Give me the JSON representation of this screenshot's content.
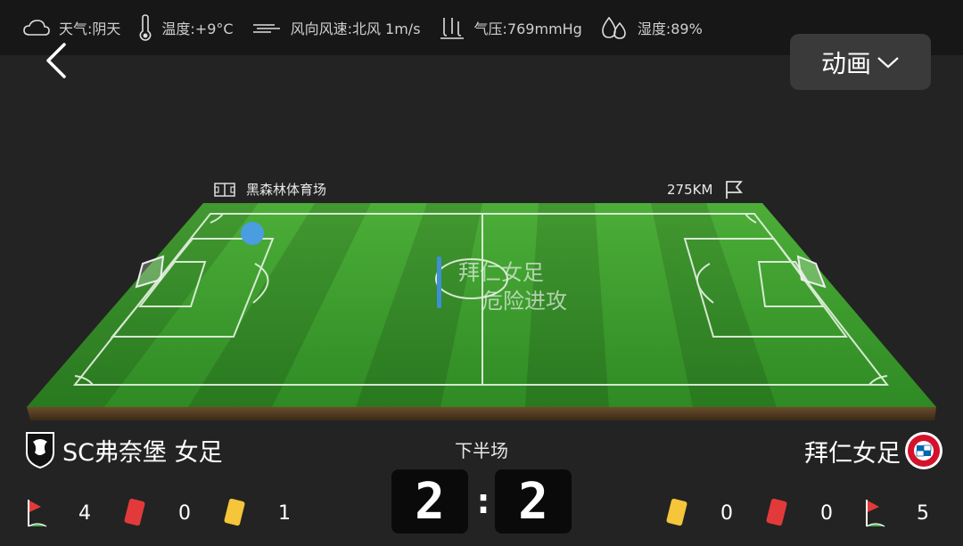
{
  "weather": {
    "condition": "天气:阴天",
    "temperature": "温度:+9°C",
    "wind": "风向风速:北风 1m/s",
    "pressure": "气压:769mmHg",
    "humidity": "湿度:89%"
  },
  "header": {
    "back_icon": "chevron-left-icon",
    "animation_label": "动画"
  },
  "venue": {
    "name": "黑森林体育场",
    "distance": "275KM"
  },
  "event": {
    "team": "拜仁女足",
    "text": "危险进攻",
    "colors": {
      "home_marker": "#4a9de0",
      "event_bar": "#3d8fd6"
    }
  },
  "match": {
    "period": "下半场",
    "home_team": "SC弗奈堡 女足",
    "away_team": "拜仁女足",
    "home_score": "2",
    "away_score": "2",
    "separator": ":"
  },
  "stats": {
    "home": {
      "corners": "4",
      "red_cards": "0",
      "yellow_cards": "1"
    },
    "away": {
      "yellow_cards": "0",
      "red_cards": "0",
      "corners": "5"
    }
  },
  "colors": {
    "yellow_card": "#f5c53a",
    "red_card": "#e23a3a",
    "pitch_green": "#3c9a2e"
  }
}
